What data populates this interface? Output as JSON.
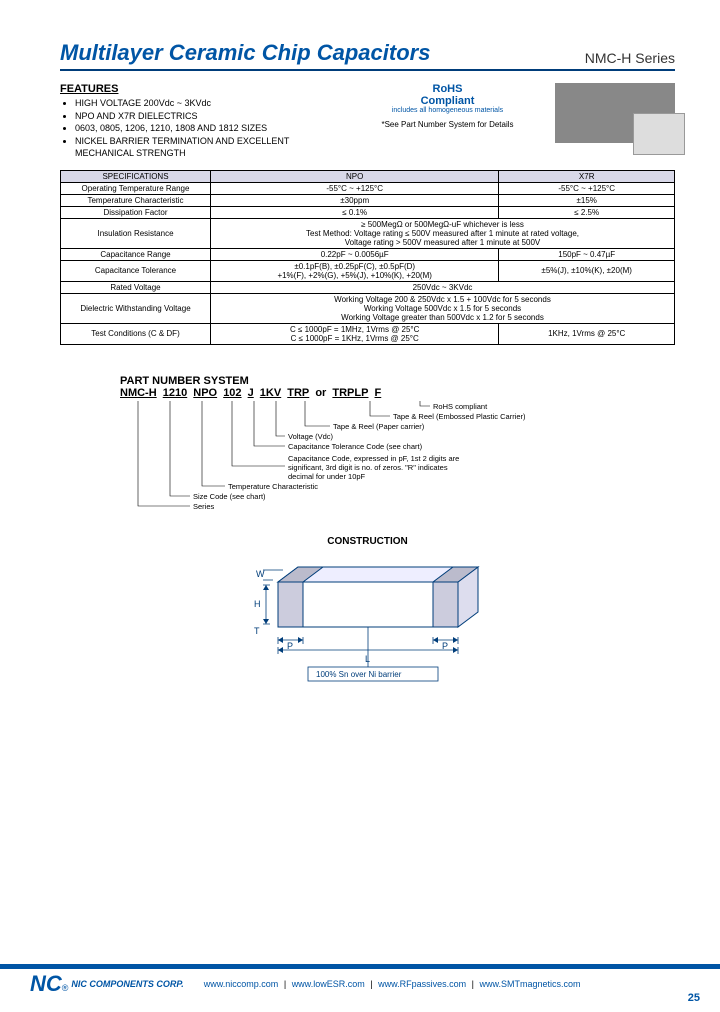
{
  "header": {
    "title": "Multilayer Ceramic Chip Capacitors",
    "series": "NMC-H Series"
  },
  "features": {
    "heading": "FEATURES",
    "items": [
      "HIGH VOLTAGE 200Vdc ~ 3KVdc",
      "NPO AND X7R DIELECTRICS",
      "0603, 0805, 1206, 1210, 1808 AND 1812 SIZES",
      "NICKEL BARRIER TERMINATION AND EXCELLENT MECHANICAL STRENGTH"
    ]
  },
  "rohs": {
    "title": "RoHS",
    "sub1": "Compliant",
    "sub2": "includes all homogeneous materials",
    "note": "*See Part Number System for Details"
  },
  "spec": {
    "headers": [
      "SPECIFICATIONS",
      "NPO",
      "X7R"
    ],
    "rows": [
      {
        "label": "Operating Temperature Range",
        "c1": "-55°C ~ +125°C",
        "c2": "-55°C ~ +125°C"
      },
      {
        "label": "Temperature Characteristic",
        "c1": "±30ppm",
        "c2": "±15%"
      },
      {
        "label": "Dissipation Factor",
        "c1": "≤ 0.1%",
        "c2": "≤ 2.5%"
      },
      {
        "label": "Insulation Resistance",
        "span": "≥ 500MegΩ or 500MegΩ-uF whichever is less\nTest Method: Voltage rating ≤ 500V measured after 1 minute at rated voltage,\nVoltage rating > 500V measured after 1 minute at 500V"
      },
      {
        "label": "Capacitance Range",
        "c1": "0.22pF ~ 0.0056µF",
        "c2": "150pF ~ 0.47µF"
      },
      {
        "label": "Capacitance Tolerance",
        "c1": "±0.1pF(B), ±0.25pF(C), ±0.5pF(D)\n+1%(F), +2%(G), +5%(J), +10%(K), +20(M)",
        "c2": "±5%(J), ±10%(K), ±20(M)"
      },
      {
        "label": "Rated Voltage",
        "span": "250Vdc ~ 3KVdc"
      },
      {
        "label": "Dielectric Withstanding Voltage",
        "span": "Working Voltage 200 & 250Vdc x 1.5 + 100Vdc for 5 seconds\nWorking Voltage 500Vdc x 1.5 for 5 seconds\nWorking Voltage greater than 500Vdc x 1.2 for 5 seconds"
      },
      {
        "label": "Test Conditions (C & DF)",
        "c1": "C ≤ 1000pF = 1MHz, 1Vrms @ 25°C\nC ≤ 1000pF = 1KHz, 1Vrms @ 25°C",
        "c2": "1KHz, 1Vrms @ 25°C"
      }
    ]
  },
  "pns": {
    "heading": "PART NUMBER SYSTEM",
    "parts": [
      "NMC-H",
      "1210",
      "NPO",
      "102",
      "J",
      "1KV",
      "TRP",
      "or",
      "TRPLP",
      "F"
    ],
    "labels": [
      "RoHS compliant",
      "Tape & Reel (Embossed Plastic Carrier)",
      "Tape & Reel (Paper carrier)",
      "Voltage (Vdc)",
      "Capacitance Tolerance Code (see chart)",
      "Capacitance Code, expressed in pF, 1st 2 digits are significant, 3rd digit is no. of zeros. \"R\" indicates decimal for under 10pF",
      "Temperature Characteristic",
      "Size Code (see chart)",
      "Series"
    ]
  },
  "construction": {
    "heading": "CONSTRUCTION",
    "labels": {
      "w": "W",
      "h": "H",
      "t": "T",
      "p1": "P",
      "p2": "P",
      "l": "L"
    },
    "note": "100% Sn over Ni barrier"
  },
  "footer": {
    "logo": "NC",
    "reg": "®",
    "corp": "NIC COMPONENTS CORP.",
    "links": [
      "www.niccomp.com",
      "www.lowESR.com",
      "www.RFpassives.com",
      "www.SMTmagnetics.com"
    ],
    "page": "25"
  }
}
